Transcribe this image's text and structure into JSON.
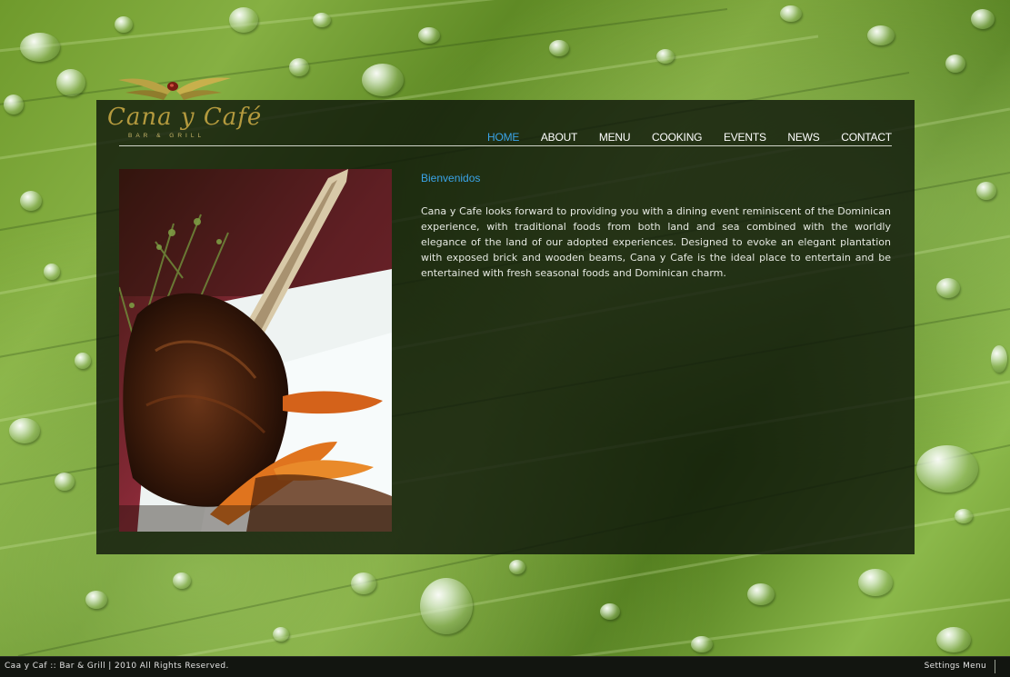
{
  "logo": {
    "name": "Cana y Café",
    "tagline": "BAR & GRILL"
  },
  "nav": {
    "items": [
      {
        "label": "HOME",
        "active": true
      },
      {
        "label": "ABOUT",
        "active": false
      },
      {
        "label": "MENU",
        "active": false
      },
      {
        "label": "COOKING",
        "active": false
      },
      {
        "label": "EVENTS",
        "active": false
      },
      {
        "label": "NEWS",
        "active": false
      },
      {
        "label": "CONTACT",
        "active": false
      }
    ]
  },
  "main": {
    "heading": "Bienvenidos",
    "intro": "Cana y Cafe looks forward to providing you with a dining event reminiscent of the Dominican experience, with traditional foods from both land and sea combined with the worldly elegance of the land of our adopted experiences. Designed to evoke an elegant plantation with exposed brick and wooden beams, Cana y Cafe is the ideal place to entertain and be entertained with fresh seasonal foods and Dominican charm."
  },
  "footer": {
    "copyright": "Caa y Caf :: Bar & Grill  |  2010 All Rights Reserved.",
    "settings_label": "Settings Menu"
  },
  "colors": {
    "accent": "#3aa4e8",
    "logo_gold": "#b49a3e",
    "panel": "#0c140a",
    "leaf_green": "#79a238"
  }
}
